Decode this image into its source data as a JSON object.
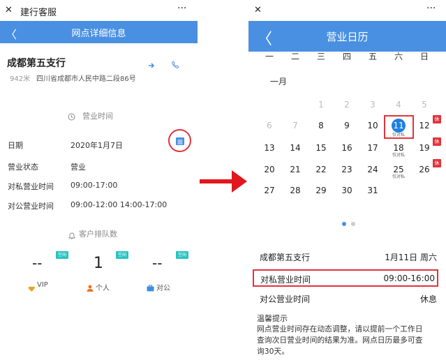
{
  "left": {
    "topbar": {
      "close": "✕",
      "title": "建行客服",
      "more": "···"
    },
    "header": {
      "back": "〈",
      "title": "网点详细信息"
    },
    "branch": {
      "name": "成都第五支行",
      "distance": "942米",
      "address": "四川省成都市人民中路二段86号"
    },
    "hours_section": {
      "title": "营业时间"
    },
    "rows": [
      {
        "label": "日期",
        "value": "2020年1月7日"
      },
      {
        "label": "营业状态",
        "value": "营业"
      },
      {
        "label": "对私营业时间",
        "value": "09:00-17:00"
      },
      {
        "label": "对公营业时间",
        "value": "09:00-12:00 14:00-17:00"
      }
    ],
    "queue_section": {
      "title": "客户排队数"
    },
    "queues": [
      {
        "value": "--",
        "label": "VIP",
        "tag": "空闲"
      },
      {
        "value": "1",
        "label": "个人",
        "tag": "空闲"
      },
      {
        "value": "--",
        "label": "对公",
        "tag": "空闲"
      }
    ]
  },
  "right": {
    "topbar": {
      "close": "✕",
      "more": "···"
    },
    "header": {
      "back": "〈",
      "title": "营业日历"
    },
    "weekdays": [
      "一",
      "二",
      "三",
      "四",
      "五",
      "六",
      "日"
    ],
    "month": "一月",
    "weeks": [
      [
        {
          "d": ""
        },
        {
          "d": ""
        },
        {
          "d": "1",
          "m": true
        },
        {
          "d": "2",
          "m": true
        },
        {
          "d": "3",
          "m": true
        },
        {
          "d": "4",
          "m": true
        },
        {
          "d": "5",
          "m": true
        }
      ],
      [
        {
          "d": "6",
          "m": true
        },
        {
          "d": "7",
          "m": true
        },
        {
          "d": "8"
        },
        {
          "d": "9"
        },
        {
          "d": "10"
        },
        {
          "d": "11",
          "sel": true,
          "sub": "仅对私"
        },
        {
          "d": "12",
          "xiu": true
        }
      ],
      [
        {
          "d": "13"
        },
        {
          "d": "14"
        },
        {
          "d": "15"
        },
        {
          "d": "16"
        },
        {
          "d": "17"
        },
        {
          "d": "18",
          "sub": "仅对私"
        },
        {
          "d": "19",
          "xiu": true
        }
      ],
      [
        {
          "d": "20"
        },
        {
          "d": "21"
        },
        {
          "d": "22"
        },
        {
          "d": "23"
        },
        {
          "d": "24"
        },
        {
          "d": "25",
          "sub": "仅对私"
        },
        {
          "d": "26",
          "xiu": true
        }
      ],
      [
        {
          "d": "27"
        },
        {
          "d": "28"
        },
        {
          "d": "29"
        },
        {
          "d": "30"
        },
        {
          "d": "31"
        },
        {
          "d": ""
        },
        {
          "d": ""
        }
      ]
    ],
    "xiu_label": "休",
    "info": [
      {
        "label": "成都第五支行",
        "value": "1月11日 周六"
      },
      {
        "label": "对私营业时间",
        "value": "09:00-16:00"
      },
      {
        "label": "对公营业时间",
        "value": "休息"
      }
    ],
    "tip": {
      "title": "温馨提示",
      "line1": "网点营业时间存在动态调整，请以提前一个工作日",
      "line2": "查询次日营业时间的结果为准。网点日历最多可查",
      "line3": "询30天。"
    }
  },
  "colors": {
    "accent": "#4a90e2",
    "red": "#e0333a",
    "teal": "#28c3c3"
  }
}
